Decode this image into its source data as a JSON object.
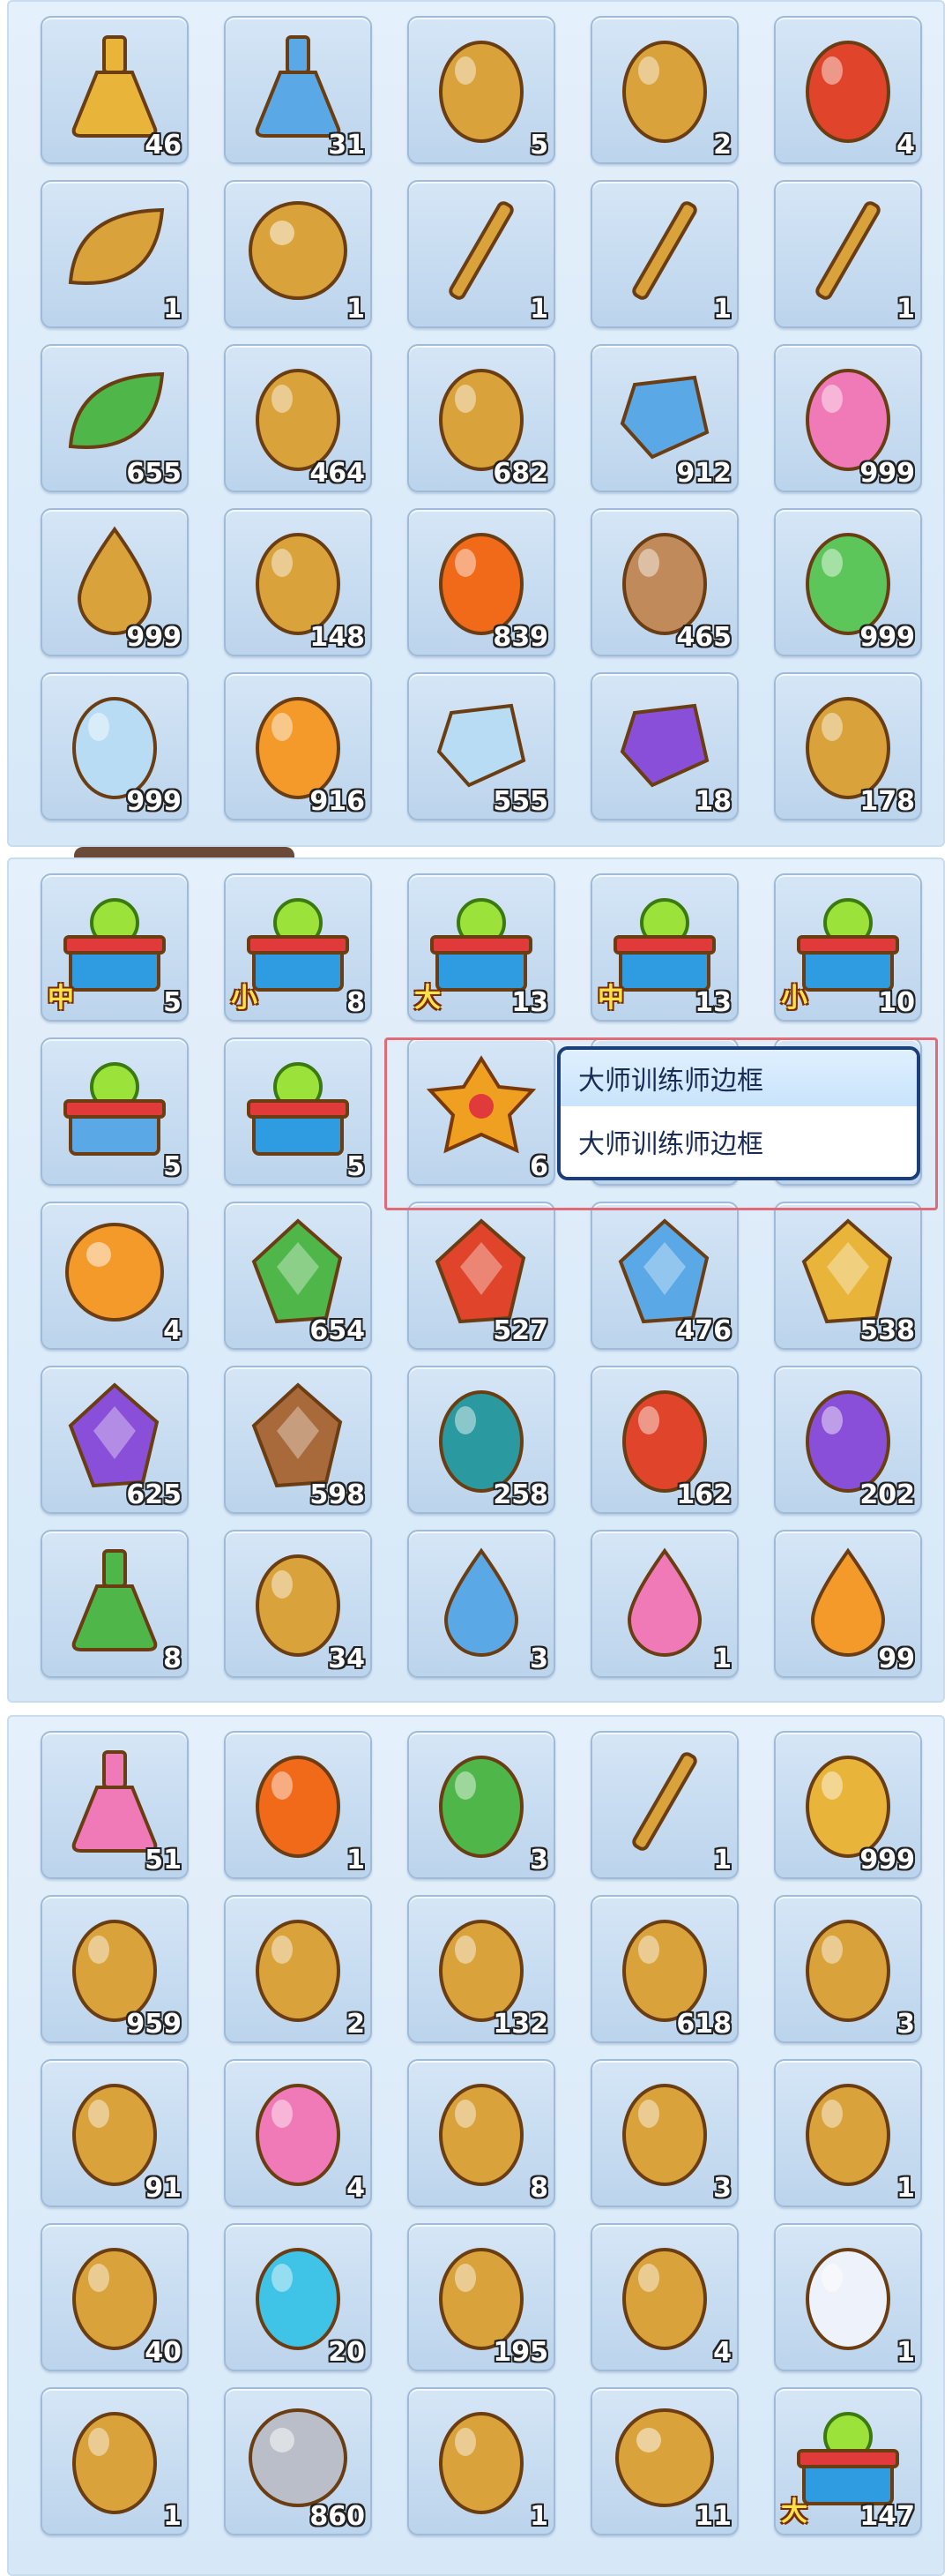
{
  "sections": [
    {
      "items": [
        {
          "icon": "gold-potion-flask-icon",
          "count": "46",
          "tag": ""
        },
        {
          "icon": "blue-potion-flask-icon",
          "count": "31",
          "tag": ""
        },
        {
          "icon": "magic-mirror-icon",
          "count": "5",
          "tag": ""
        },
        {
          "icon": "lantern-icon",
          "count": "2",
          "tag": ""
        },
        {
          "icon": "red-dragon-icon",
          "count": "4",
          "tag": ""
        },
        {
          "icon": "leaf-medal-icon",
          "count": "1",
          "tag": ""
        },
        {
          "icon": "crystal-ball-icon",
          "count": "1",
          "tag": ""
        },
        {
          "icon": "broom-icon",
          "count": "1",
          "tag": ""
        },
        {
          "icon": "wooden-stick-icon",
          "count": "1",
          "tag": ""
        },
        {
          "icon": "paint-brush-icon",
          "count": "1",
          "tag": ""
        },
        {
          "icon": "green-leaf-icon",
          "count": "655",
          "tag": ""
        },
        {
          "icon": "scroll-icon",
          "count": "464",
          "tag": ""
        },
        {
          "icon": "yellow-feather-icon",
          "count": "682",
          "tag": ""
        },
        {
          "icon": "blue-crystal-icon",
          "count": "912",
          "tag": ""
        },
        {
          "icon": "pink-flower-icon",
          "count": "999",
          "tag": ""
        },
        {
          "icon": "water-drop-icon",
          "count": "999",
          "tag": ""
        },
        {
          "icon": "wood-log-icon",
          "count": "148",
          "tag": ""
        },
        {
          "icon": "fire-egg-icon",
          "count": "839",
          "tag": ""
        },
        {
          "icon": "earth-egg-icon",
          "count": "465",
          "tag": ""
        },
        {
          "icon": "grass-egg-icon",
          "count": "999",
          "tag": ""
        },
        {
          "icon": "ice-egg-icon",
          "count": "999",
          "tag": ""
        },
        {
          "icon": "orange-egg-icon",
          "count": "916",
          "tag": ""
        },
        {
          "icon": "ice-crystal-icon",
          "count": "555",
          "tag": ""
        },
        {
          "icon": "purple-crystal-icon",
          "count": "18",
          "tag": ""
        },
        {
          "icon": "grape-cluster-icon",
          "count": "178",
          "tag": ""
        }
      ]
    },
    {
      "items": [
        {
          "icon": "clover-gift-box-icon",
          "count": "5",
          "tag": "中"
        },
        {
          "icon": "clover-gift-box-icon",
          "count": "8",
          "tag": "小"
        },
        {
          "icon": "star-gift-box-icon",
          "count": "13",
          "tag": "大"
        },
        {
          "icon": "star-gift-box-icon",
          "count": "13",
          "tag": "中"
        },
        {
          "icon": "star-gift-box-icon",
          "count": "10",
          "tag": "小"
        },
        {
          "icon": "blue-gem-box-icon",
          "count": "5",
          "tag": ""
        },
        {
          "icon": "heart-gift-box-icon",
          "count": "5",
          "tag": ""
        },
        {
          "icon": "master-trainer-frame-icon",
          "count": "6",
          "tag": ""
        },
        {
          "icon": "hidden-item-icon",
          "count": "",
          "tag": ""
        },
        {
          "icon": "hidden-item-icon",
          "count": "",
          "tag": ""
        },
        {
          "icon": "orange-blob-orb-icon",
          "count": "4",
          "tag": ""
        },
        {
          "icon": "green-shard-icon",
          "count": "654",
          "tag": ""
        },
        {
          "icon": "red-shard-icon",
          "count": "527",
          "tag": ""
        },
        {
          "icon": "blue-shard-icon",
          "count": "476",
          "tag": ""
        },
        {
          "icon": "gold-shard-icon",
          "count": "538",
          "tag": ""
        },
        {
          "icon": "purple-shard-icon",
          "count": "625",
          "tag": ""
        },
        {
          "icon": "brown-shard-icon",
          "count": "598",
          "tag": ""
        },
        {
          "icon": "teal-dragon-egg-icon",
          "count": "258",
          "tag": ""
        },
        {
          "icon": "red-dragon-egg-icon",
          "count": "162",
          "tag": ""
        },
        {
          "icon": "purple-dragon-egg-icon",
          "count": "202",
          "tag": ""
        },
        {
          "icon": "green-potion-sack-icon",
          "count": "8",
          "tag": ""
        },
        {
          "icon": "shirt-card-icon",
          "count": "34",
          "tag": ""
        },
        {
          "icon": "blue-flame-drop-icon",
          "count": "3",
          "tag": ""
        },
        {
          "icon": "pink-flame-drop-icon",
          "count": "1",
          "tag": ""
        },
        {
          "icon": "orange-flame-drop-icon",
          "count": "99",
          "tag": ""
        }
      ]
    },
    {
      "items": [
        {
          "icon": "pink-potion-icon",
          "count": "51",
          "tag": ""
        },
        {
          "icon": "fire-bird-egg-icon",
          "count": "1",
          "tag": ""
        },
        {
          "icon": "green-sparkle-egg-icon",
          "count": "3",
          "tag": ""
        },
        {
          "icon": "flute-icon",
          "count": "1",
          "tag": ""
        },
        {
          "icon": "golden-plant-icon",
          "count": "999",
          "tag": ""
        },
        {
          "icon": "horse-toy-icon",
          "count": "959",
          "tag": ""
        },
        {
          "icon": "cow-egg-icon",
          "count": "2",
          "tag": ""
        },
        {
          "icon": "film-roll-icon",
          "count": "132",
          "tag": ""
        },
        {
          "icon": "book-icon",
          "count": "618",
          "tag": ""
        },
        {
          "icon": "helmet-egg-icon",
          "count": "3",
          "tag": ""
        },
        {
          "icon": "stone-tablet-icon",
          "count": "91",
          "tag": ""
        },
        {
          "icon": "pink-crystal-egg-icon",
          "count": "4",
          "tag": ""
        },
        {
          "icon": "fluffy-egg-icon",
          "count": "8",
          "tag": ""
        },
        {
          "icon": "girl-egg-icon",
          "count": "3",
          "tag": ""
        },
        {
          "icon": "fox-egg-icon",
          "count": "1",
          "tag": ""
        },
        {
          "icon": "bone-skull-icon",
          "count": "40",
          "tag": ""
        },
        {
          "icon": "cyan-egg-icon",
          "count": "20",
          "tag": ""
        },
        {
          "icon": "plant-pod-icon",
          "count": "195",
          "tag": ""
        },
        {
          "icon": "pig-egg-icon",
          "count": "4",
          "tag": ""
        },
        {
          "icon": "white-cat-egg-icon",
          "count": "1",
          "tag": ""
        },
        {
          "icon": "duck-egg-icon",
          "count": "1",
          "tag": ""
        },
        {
          "icon": "silver-coin-icon",
          "count": "860",
          "tag": ""
        },
        {
          "icon": "fish-egg-icon",
          "count": "1",
          "tag": ""
        },
        {
          "icon": "bear-orb-icon",
          "count": "11",
          "tag": ""
        },
        {
          "icon": "clover-gift-box-icon",
          "count": "147",
          "tag": "大"
        }
      ]
    }
  ],
  "tooltip": {
    "title": "大师训练师边框",
    "subtitle": "大师训练师边框"
  },
  "colors": {
    "panel_bg": "#dceaf8",
    "slot_bg": "#c8dcf0",
    "tooltip_border": "#1c3f7a",
    "highlight_border": "#e06a78"
  }
}
